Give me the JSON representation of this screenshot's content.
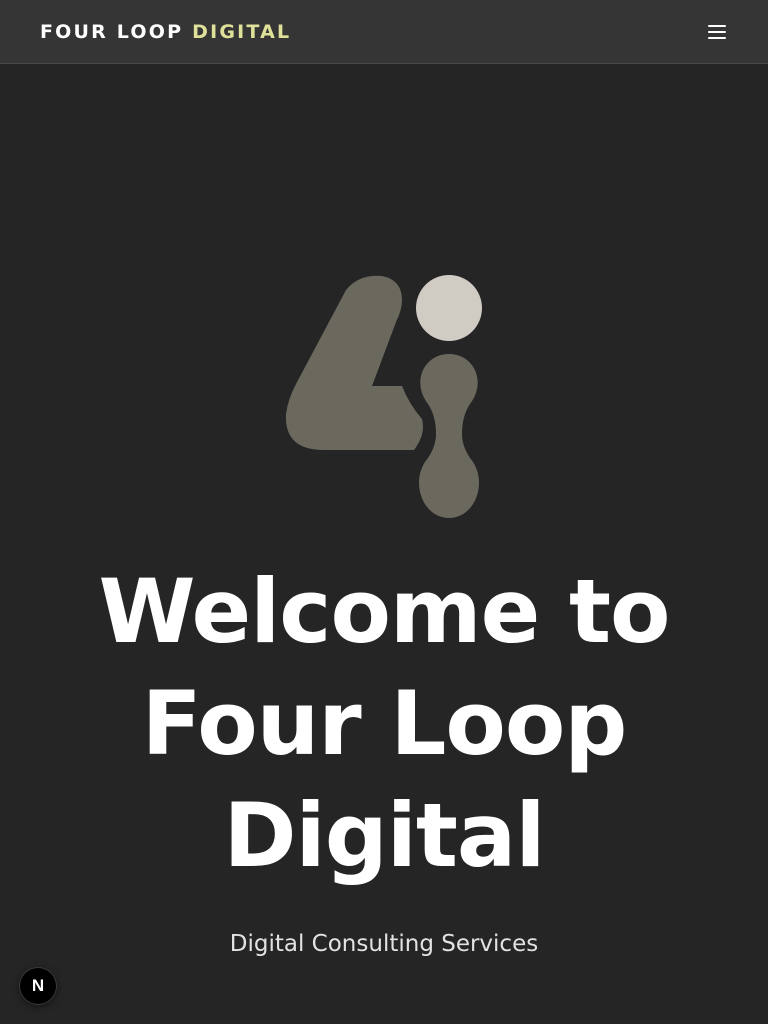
{
  "header": {
    "brand_part1": "FOUR LOOP",
    "brand_part2": "DIGITAL",
    "menu_icon": "hamburger-menu-icon"
  },
  "hero": {
    "logo_icon": "four-loop-digital-logo",
    "title_line1": "Welcome to",
    "title_line2": "Four Loop",
    "title_line3": "Digital",
    "subtitle": "Digital Consulting Services"
  },
  "dev_badge": {
    "label": "N",
    "icon": "nextjs-dev-indicator-icon"
  },
  "colors": {
    "background": "#252526",
    "header_background": "#353535",
    "brand_accent": "#dfe19a",
    "logo_dark": "#6b695e",
    "logo_light": "#d0ccc4",
    "text_primary": "#ffffff"
  }
}
